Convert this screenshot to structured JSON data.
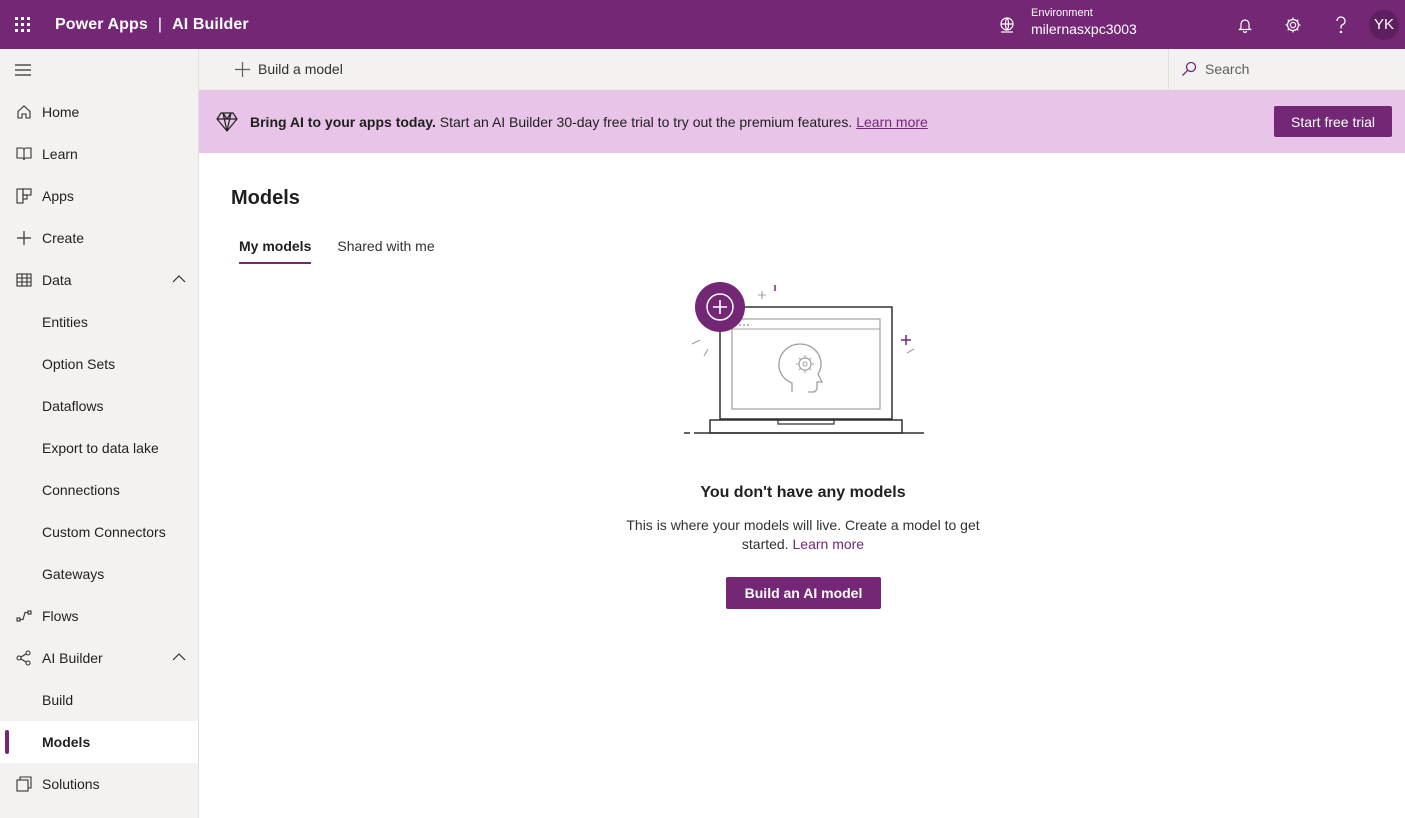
{
  "topbar": {
    "app_name": "Power Apps",
    "separator": "|",
    "product_name": "AI Builder",
    "environment_label": "Environment",
    "environment_name": "milernasxpc3003",
    "avatar_initials": "YK",
    "icons": [
      "waffle-icon",
      "environment-icon",
      "bell-icon",
      "gear-icon",
      "help-icon"
    ]
  },
  "sidebar": {
    "items": [
      {
        "label": "Home",
        "icon": "home-icon"
      },
      {
        "label": "Learn",
        "icon": "book-icon"
      },
      {
        "label": "Apps",
        "icon": "apps-icon"
      },
      {
        "label": "Create",
        "icon": "plus-icon"
      },
      {
        "label": "Data",
        "icon": "table-icon",
        "expanded": true
      },
      {
        "label": "Entities"
      },
      {
        "label": "Option Sets"
      },
      {
        "label": "Dataflows"
      },
      {
        "label": "Export to data lake"
      },
      {
        "label": "Connections"
      },
      {
        "label": "Custom Connectors"
      },
      {
        "label": "Gateways"
      },
      {
        "label": "Flows",
        "icon": "flow-icon"
      },
      {
        "label": "AI Builder",
        "icon": "ai-builder-icon",
        "expanded": true
      },
      {
        "label": "Build"
      },
      {
        "label": "Models",
        "active": true
      },
      {
        "label": "Solutions",
        "icon": "solutions-icon"
      }
    ]
  },
  "commandbar": {
    "build_model_label": "Build a model",
    "search_placeholder": "Search"
  },
  "banner": {
    "bold_text": "Bring AI to your apps today.",
    "text": "Start an AI Builder 30-day free trial to try out the premium features.",
    "link": "Learn more",
    "button": "Start free trial"
  },
  "main": {
    "title": "Models",
    "tabs": [
      {
        "label": "My models",
        "active": true
      },
      {
        "label": "Shared with me",
        "active": false
      }
    ],
    "empty_title": "You don't have any models",
    "empty_desc": "This is where your models will live. Create a model to get started.",
    "empty_link": "Learn more",
    "build_button": "Build an AI model"
  },
  "colors": {
    "brand": "#742774",
    "banner_bg": "#e8c4e8",
    "sidebar_bg": "#f3f2f1"
  }
}
